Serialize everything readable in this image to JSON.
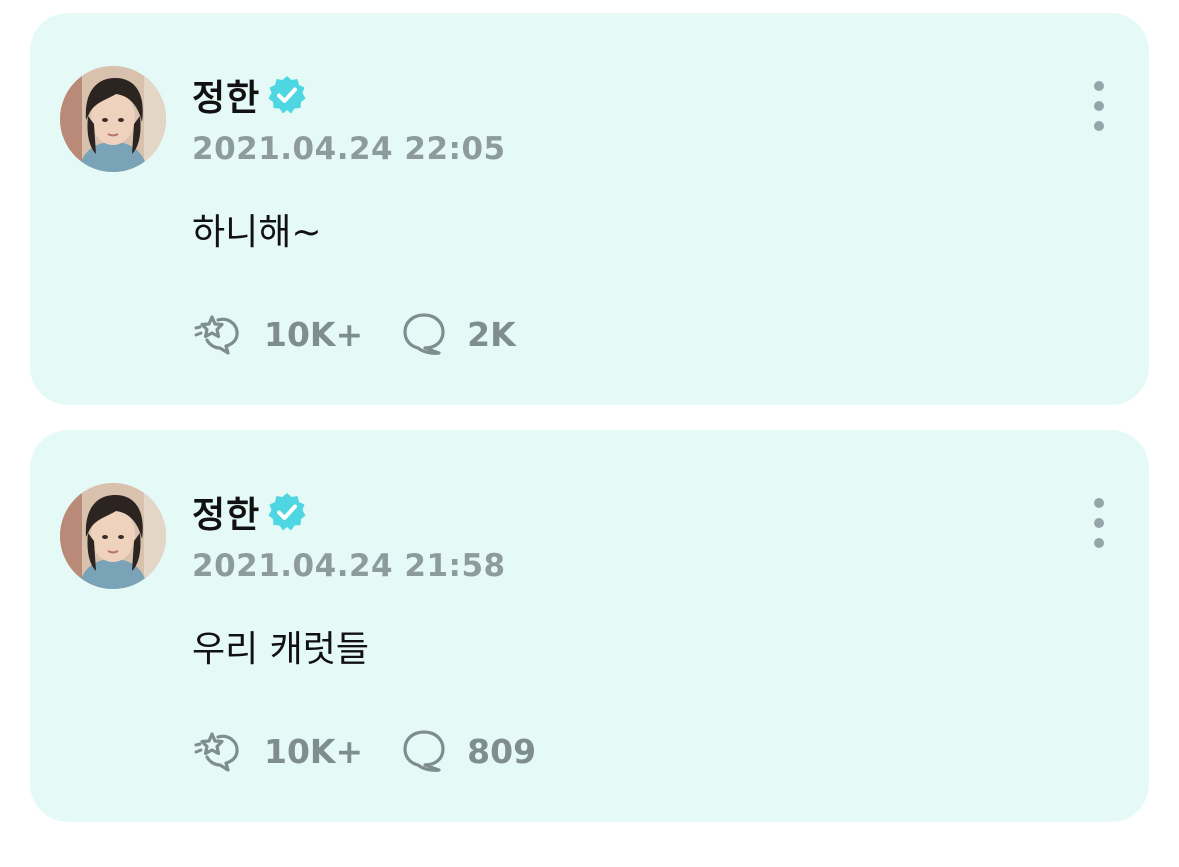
{
  "colors": {
    "card_background": "#e5faf6",
    "verified_badge": "#4fd6e3",
    "muted_text": "#8d9b9f",
    "icon_gray": "#7f8d91"
  },
  "posts": [
    {
      "author": "정한",
      "verified": true,
      "timestamp": "2021.04.24 22:05",
      "text": "하니해~",
      "reactions": {
        "icon": "cheer-icon",
        "count": "10K+"
      },
      "comments": {
        "icon": "comment-bubble-icon",
        "count": "2K"
      }
    },
    {
      "author": "정한",
      "verified": true,
      "timestamp": "2021.04.24 21:58",
      "text": "우리 캐럿들",
      "reactions": {
        "icon": "cheer-icon",
        "count": "10K+"
      },
      "comments": {
        "icon": "comment-bubble-icon",
        "count": "809"
      }
    }
  ]
}
